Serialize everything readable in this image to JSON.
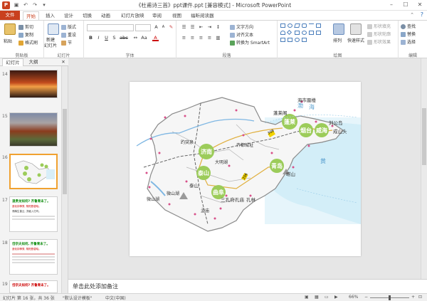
{
  "window": {
    "title": "《杜甫诗三首》ppt课件.ppt [兼容模式] - Microsoft PowerPoint",
    "minimize": "–",
    "maximize": "☐",
    "close": "✕",
    "app_icon": "P"
  },
  "tabs": [
    "文件",
    "开始",
    "插入",
    "设计",
    "切换",
    "动画",
    "幻灯片放映",
    "审阅",
    "视图",
    "福昕阅读器"
  ],
  "ribbon": {
    "clipboard": {
      "paste": "粘贴",
      "cut": "剪切",
      "copy": "复制",
      "format_painter": "格式刷",
      "label": "剪贴板"
    },
    "slides": {
      "new_slide": "新建",
      "new_slide2": "幻灯片",
      "layout": "版式",
      "reset": "重设",
      "section": "节",
      "label": "幻灯片"
    },
    "font": {
      "label": "字体",
      "bold": "B",
      "italic": "I",
      "underline": "U",
      "strike": "S",
      "shadow": "abc",
      "grow": "A",
      "shrink": "A"
    },
    "paragraph": {
      "text_direction": "文字方向",
      "align_text": "对齐文本",
      "smartart": "转换为 SmartArt",
      "label": "段落"
    },
    "drawing": {
      "arrange": "排列",
      "quick_styles": "快速样式",
      "shape_fill": "形状填充",
      "shape_outline": "形状轮廓",
      "shape_effects": "形状效果",
      "label": "绘图"
    },
    "editing": {
      "find": "查找",
      "replace": "替换",
      "select": "选择",
      "label": "编辑"
    }
  },
  "left_pane": {
    "tab_slides": "幻灯片",
    "tab_outline": "大纲",
    "close": "✕",
    "thumbs": [
      {
        "num": "14"
      },
      {
        "num": "15"
      },
      {
        "num": "16"
      },
      {
        "num": "17",
        "line1": "温贵龙如何? 齐鲁青未了。",
        "line2": "造化钟神秀, 阴阳割昏晓。",
        "line3": "荡胸生曾云, 决眦入归鸟。"
      },
      {
        "num": "18",
        "line1": "岱宗夫如何, 齐鲁青未了。",
        "line2": "造化钟神秀, 阴阳割昏晓。"
      },
      {
        "num": "19",
        "line1": "岱宗夫如何? 齐鲁青未了。"
      }
    ]
  },
  "map": {
    "cities": [
      "济南",
      "泰山",
      "曲阜",
      "蓬莱",
      "烟台",
      "威海",
      "青岛"
    ],
    "labels": [
      "海市蜃楼",
      "蓬莱阁",
      "刘公岛",
      "成山头",
      "三孔府",
      "孔庙",
      "孔林",
      "泰山",
      "崂山",
      "海",
      "黄",
      "渤",
      "趵突泉",
      "大明湖",
      "齐都城址",
      "孟庙",
      "微山湖",
      "微山湖"
    ],
    "highways": [
      "308",
      "206"
    ]
  },
  "notes": "单击此处添加备注",
  "status": {
    "slide_info": "幻灯片 第 16 张，共 36 张",
    "theme": "\"默认设计模板\"",
    "language": "中文(中国)",
    "zoom": "66%",
    "zoom_level": 0.5
  }
}
